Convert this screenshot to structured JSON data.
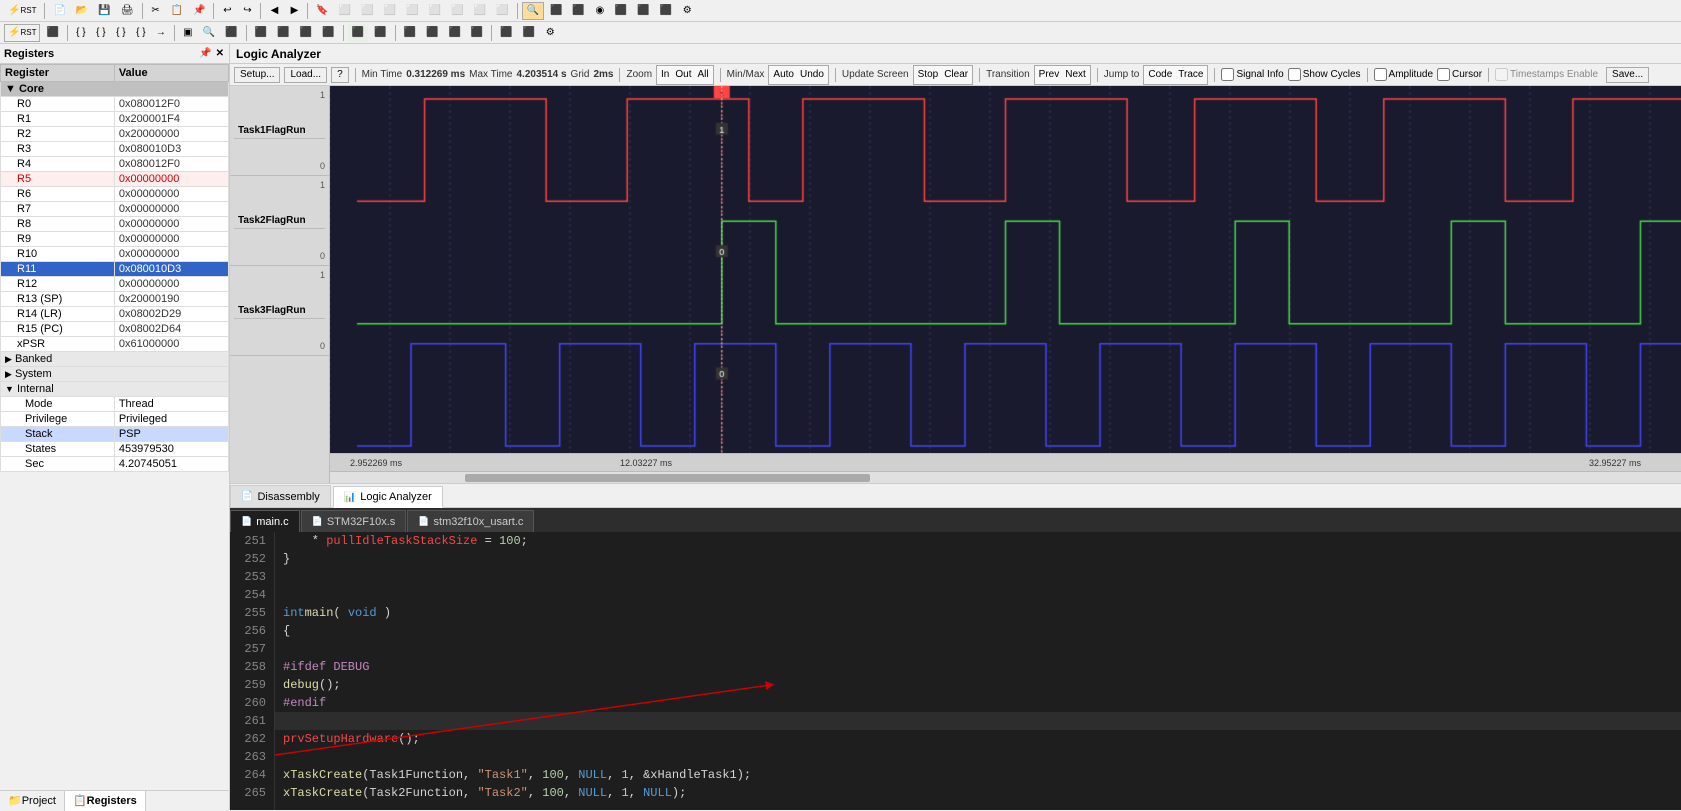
{
  "toolbar1": {
    "buttons": [
      "RST",
      "⏹",
      "▶",
      "{}",
      "{}",
      "{}",
      "{}",
      "→",
      "▣",
      "🔍",
      "⬛",
      "⬛",
      "⬛",
      "⬛",
      "⬛",
      "⬛",
      "⬛",
      "⬛",
      "⬛"
    ]
  },
  "toolbar2": {
    "buttons": [
      "⚡RST",
      "⏸",
      "{}",
      "{}",
      "{}",
      "→",
      "▣",
      "🔎",
      "⬛",
      "⬛",
      "⬛",
      "⬛",
      "⬛",
      "⬛",
      "⬛",
      "⬛",
      "⬛",
      "⬛",
      "⬛",
      "⬛",
      "⬛",
      "⬛",
      "⬛",
      "⬛"
    ]
  },
  "leftPanel": {
    "title": "Registers",
    "columnRegister": "Register",
    "columnValue": "Value",
    "registers": [
      {
        "name": "Core",
        "value": "",
        "type": "core-header"
      },
      {
        "name": "R0",
        "value": "0x080012F0",
        "type": "normal"
      },
      {
        "name": "R1",
        "value": "0x200001F4",
        "type": "normal"
      },
      {
        "name": "R2",
        "value": "0x20000000",
        "type": "normal"
      },
      {
        "name": "R3",
        "value": "0x080010D3",
        "type": "normal"
      },
      {
        "name": "R4",
        "value": "0x080012F0",
        "type": "normal"
      },
      {
        "name": "R5",
        "value": "0x00000000",
        "type": "highlight"
      },
      {
        "name": "R6",
        "value": "0x00000000",
        "type": "normal"
      },
      {
        "name": "R7",
        "value": "0x00000000",
        "type": "normal"
      },
      {
        "name": "R8",
        "value": "0x00000000",
        "type": "normal"
      },
      {
        "name": "R9",
        "value": "0x00000000",
        "type": "normal"
      },
      {
        "name": "R10",
        "value": "0x00000000",
        "type": "normal"
      },
      {
        "name": "R11",
        "value": "0x080010D3",
        "type": "selected"
      },
      {
        "name": "R12",
        "value": "0x00000000",
        "type": "normal"
      },
      {
        "name": "R13 (SP)",
        "value": "0x20000190",
        "type": "normal"
      },
      {
        "name": "R14 (LR)",
        "value": "0x08002D29",
        "type": "normal"
      },
      {
        "name": "R15 (PC)",
        "value": "0x08002D64",
        "type": "normal"
      },
      {
        "name": "xPSR",
        "value": "0x61000000",
        "type": "normal",
        "expand": true
      },
      {
        "name": "Banked",
        "value": "",
        "type": "group"
      },
      {
        "name": "System",
        "value": "",
        "type": "group"
      },
      {
        "name": "Internal",
        "value": "",
        "type": "group-expanded"
      },
      {
        "name": "Mode",
        "value": "Thread",
        "type": "child"
      },
      {
        "name": "Privilege",
        "value": "Privileged",
        "type": "child"
      },
      {
        "name": "Stack",
        "value": "PSP",
        "type": "child-selected"
      },
      {
        "name": "States",
        "value": "453979530",
        "type": "child"
      },
      {
        "name": "Sec",
        "value": "4.20745051",
        "type": "child"
      }
    ],
    "bottomTabs": [
      "Project",
      "Registers"
    ]
  },
  "logicAnalyzer": {
    "title": "Logic Analyzer",
    "toolbar": {
      "setupLabel": "Setup...",
      "loadLabel": "Load...",
      "saveLabel": "Save...",
      "helpLabel": "?",
      "minTimeLabel": "Min Time",
      "minTimeValue": "0.312269 ms",
      "maxTimeLabel": "Max Time",
      "maxTimeValue": "4.203514 s",
      "gridLabel": "Grid",
      "gridValue": "2ms",
      "zoomLabel": "Zoom",
      "zoomIn": "In",
      "zoomOut": "Out",
      "zoomAll": "All",
      "minMaxLabel": "Min/Max",
      "minMaxAuto": "Auto",
      "minMaxUndo": "Undo",
      "updateScreen": "Update Screen",
      "stopLabel": "Stop",
      "clearLabel": "Clear",
      "transition": "Transition",
      "prevLabel": "Prev",
      "nextLabel": "Next",
      "jumpTo": "Jump to",
      "codeLabel": "Code",
      "traceLabel": "Trace",
      "signalInfo": "Signal Info",
      "showCycles": "Show Cycles",
      "amplitude": "Amplitude",
      "cursor": "Cursor",
      "timestampsEnable": "Timestamps Enable"
    },
    "signals": [
      {
        "name": "Task1FlagRun",
        "color": "#ff4444"
      },
      {
        "name": "Task2FlagRun",
        "color": "#44ff44"
      },
      {
        "name": "Task3FlagRun",
        "color": "#4444ff"
      }
    ],
    "timeLabels": [
      "2.952269 ms",
      "12.03227 ms",
      "32.95227 ms"
    ],
    "cursorValue1": "1",
    "cursorValue0": "0",
    "cursorMarker": "12.03227 ms"
  },
  "viewTabs": [
    {
      "label": "Disassembly",
      "icon": "📄",
      "active": false
    },
    {
      "label": "Logic Analyzer",
      "icon": "📊",
      "active": true
    }
  ],
  "fileTabs": [
    {
      "label": "main.c",
      "icon": "c",
      "active": true
    },
    {
      "label": "STM32F10x.s",
      "icon": "s",
      "active": false
    },
    {
      "label": "stm32f10x_usart.c",
      "icon": "c",
      "active": false
    }
  ],
  "codeLines": [
    {
      "num": 251,
      "text": "    * pullIdleTaskStackSize = 100;",
      "hasGreen": true,
      "hasBreakpoint": false,
      "isCurrent": false
    },
    {
      "num": 252,
      "text": "}",
      "hasGreen": false,
      "hasBreakpoint": false,
      "isCurrent": false
    },
    {
      "num": 253,
      "text": "",
      "hasGreen": false,
      "hasBreakpoint": false,
      "isCurrent": false
    },
    {
      "num": 254,
      "text": "",
      "hasGreen": false,
      "hasBreakpoint": false,
      "isCurrent": false
    },
    {
      "num": 255,
      "text": "int main( void )",
      "hasGreen": false,
      "hasBreakpoint": false,
      "isCurrent": false
    },
    {
      "num": 256,
      "text": "{",
      "hasGreen": true,
      "hasBreakpoint": false,
      "isCurrent": false,
      "isExpand": true
    },
    {
      "num": 257,
      "text": "",
      "hasGreen": false,
      "hasBreakpoint": false,
      "isCurrent": false
    },
    {
      "num": 258,
      "text": "#ifdef DEBUG",
      "hasGreen": true,
      "hasBreakpoint": false,
      "isCurrent": false,
      "isExpand": true,
      "isPP": true
    },
    {
      "num": 259,
      "text": "    debug();",
      "hasGreen": false,
      "hasBreakpoint": false,
      "isCurrent": false
    },
    {
      "num": 260,
      "text": "#endif",
      "hasGreen": false,
      "hasBreakpoint": false,
      "isCurrent": false,
      "isPP": true
    },
    {
      "num": 261,
      "text": "",
      "hasGreen": false,
      "hasBreakpoint": false,
      "isCurrent": true,
      "hasArrow": true
    },
    {
      "num": 262,
      "text": "    prvSetupHardware();",
      "hasGreen": false,
      "hasBreakpoint": true,
      "isCurrent": false
    },
    {
      "num": 263,
      "text": "",
      "hasGreen": false,
      "hasBreakpoint": false,
      "isCurrent": false
    },
    {
      "num": 264,
      "text": "    xTaskCreate(Task1Function, \"Task1\", 100, NULL, 1, &xHandleTask1);",
      "hasGreen": false,
      "hasBreakpoint": false,
      "isCurrent": false
    },
    {
      "num": 265,
      "text": "    xTaskCreate(Task2Function, \"Task2\", 100, NULL, 1, NULL);",
      "hasGreen": false,
      "hasBreakpoint": false,
      "isCurrent": false
    }
  ]
}
